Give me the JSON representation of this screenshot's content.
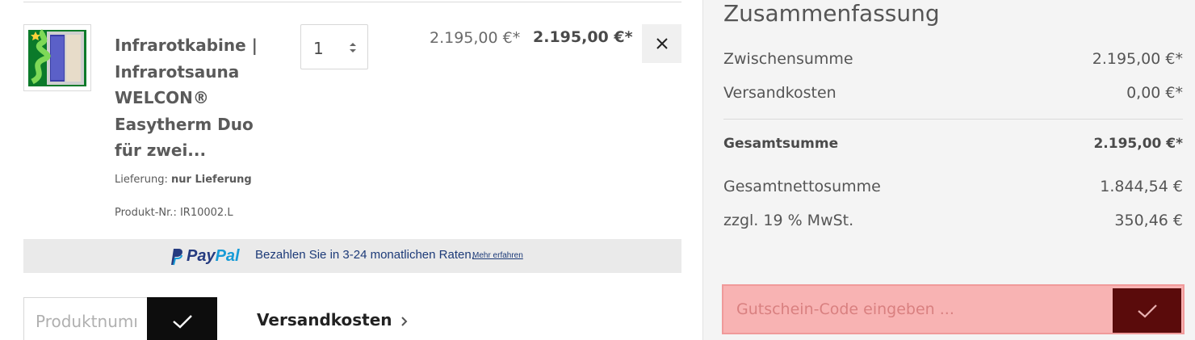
{
  "cart": {
    "item": {
      "title": "Infrarotkabine | Infrarotsauna WELCON® Easytherm Duo für zwei...",
      "delivery_label": "Lieferung:",
      "delivery_value": "nur Lieferung",
      "sku_label": "Produkt-Nr.:",
      "sku_value": "IR10002.L",
      "quantity": "1",
      "unit_price": "2.195,00 €*",
      "total_price": "2.195,00 €*",
      "remove_icon": "close-icon",
      "thumbnail_icon": "infrared-cabin-image"
    },
    "paypal": {
      "logo_pay": "Pay",
      "logo_pal": "Pal",
      "text": "Bezahlen Sie in 3-24 monatlichen Raten.",
      "more_link": "Mehr erfahren",
      "colors": {
        "dark": "#253b80",
        "light": "#179bd7"
      }
    },
    "product_number": {
      "placeholder": "Produktnummer eingeben ...",
      "submit_icon": "checkmark-icon"
    },
    "shipping_link": {
      "label": "Versandkosten",
      "icon": "chevron-right-icon"
    }
  },
  "summary": {
    "title": "Zusammenfassung",
    "subtotal_label": "Zwischensumme",
    "subtotal_value": "2.195,00 €*",
    "shipping_label": "Versandkosten",
    "shipping_value": "0,00 €*",
    "total_label": "Gesamtsumme",
    "total_value": "2.195,00 €*",
    "net_label": "Gesamtnettosumme",
    "net_value": "1.844,54 €",
    "vat_label": "zzgl. 19 % MwSt.",
    "vat_value": "350,46 €"
  },
  "coupon": {
    "placeholder": "Gutschein-Code eingeben ...",
    "submit_icon": "checkmark-icon",
    "colors": {
      "background": "#f8b3b3",
      "button": "#5a0b0b"
    }
  }
}
